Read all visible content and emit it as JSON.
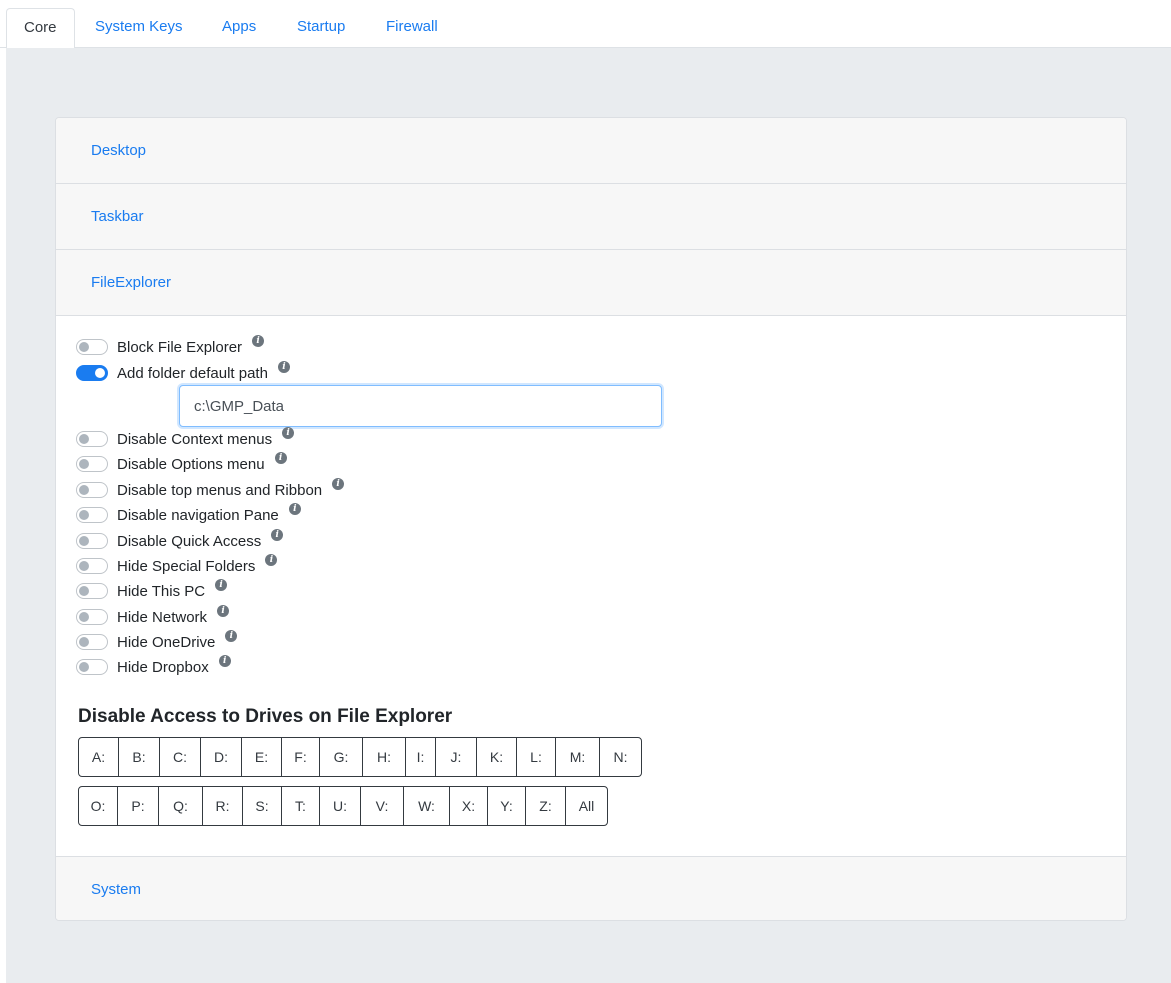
{
  "tabs": [
    {
      "label": "Core",
      "active": true
    },
    {
      "label": "System Keys",
      "active": false
    },
    {
      "label": "Apps",
      "active": false
    },
    {
      "label": "Startup",
      "active": false
    },
    {
      "label": "Firewall",
      "active": false
    }
  ],
  "accordion": {
    "sections": [
      "Desktop",
      "Taskbar",
      "FileExplorer",
      "System"
    ],
    "expanded": "FileExplorer"
  },
  "file_explorer": {
    "options": [
      {
        "label": "Block File Explorer",
        "enabled": false
      },
      {
        "label": "Add folder default path",
        "enabled": true
      },
      {
        "label": "Disable Context menus",
        "enabled": false
      },
      {
        "label": "Disable Options menu",
        "enabled": false
      },
      {
        "label": "Disable top menus and Ribbon",
        "enabled": false
      },
      {
        "label": "Disable navigation Pane",
        "enabled": false
      },
      {
        "label": "Disable Quick Access",
        "enabled": false
      },
      {
        "label": "Hide Special Folders",
        "enabled": false
      },
      {
        "label": "Hide This PC",
        "enabled": false
      },
      {
        "label": "Hide Network",
        "enabled": false
      },
      {
        "label": "Hide OneDrive",
        "enabled": false
      },
      {
        "label": "Hide Dropbox",
        "enabled": false
      }
    ],
    "default_path_value": "c:\\GMP_Data",
    "drives_title": "Disable Access to Drives on File Explorer",
    "drives_row1": [
      "A:",
      "B:",
      "C:",
      "D:",
      "E:",
      "F:",
      "G:",
      "H:",
      "I:",
      "J:",
      "K:",
      "L:",
      "M:",
      "N:"
    ],
    "drives_row2": [
      "O:",
      "P:",
      "Q:",
      "R:",
      "S:",
      "T:",
      "U:",
      "V:",
      "W:",
      "X:",
      "Y:",
      "Z:",
      "All"
    ]
  },
  "colors": {
    "accent": "#1a7cf0",
    "panel_background": "#e9ecef",
    "header_background": "#f7f7f7"
  }
}
